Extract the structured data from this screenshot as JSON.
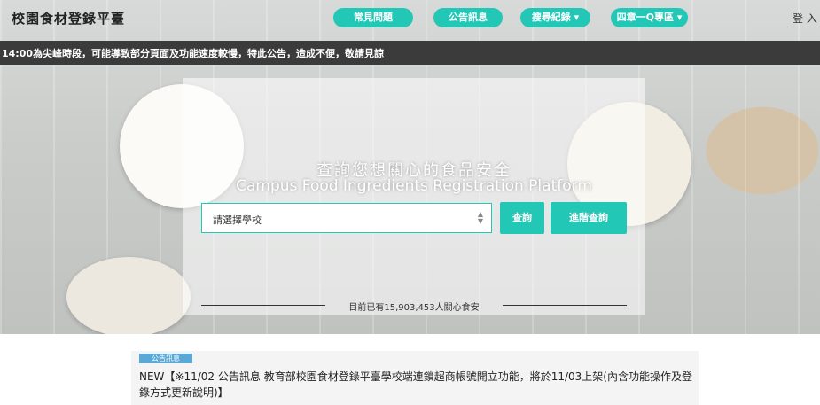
{
  "header": {
    "site_title": "校園食材登錄平臺",
    "nav": [
      "常見問題",
      "公告訊息",
      "搜尋紀錄 ▾",
      "四章一Q專區 ▾"
    ],
    "login": "登 入"
  },
  "ticker": {
    "text": "14:00為尖峰時段，可能導致部分頁面及功能速度較慢，特此公告，造成不便，敬請見諒"
  },
  "search": {
    "headline": "查詢您想關心的食品安全",
    "subline": "Campus Food Ingredients Registration Platform",
    "school_select": "請選擇學校",
    "search_button": "查詢",
    "advanced_button": "進階查詢",
    "counter": "目前已有15,903,453人關心食安"
  },
  "news": {
    "badge": "公告訊息",
    "text": "NEW【※11/02 公告訊息 教育部校園食材登錄平臺學校端連鎖超商帳號開立功能，將於11/03上架(內含功能操作及登錄方式更新說明)】"
  },
  "colors": {
    "accent": "#22c7b5",
    "ticker_bg": "#3b3b3b",
    "badge": "#5aa8d6"
  }
}
